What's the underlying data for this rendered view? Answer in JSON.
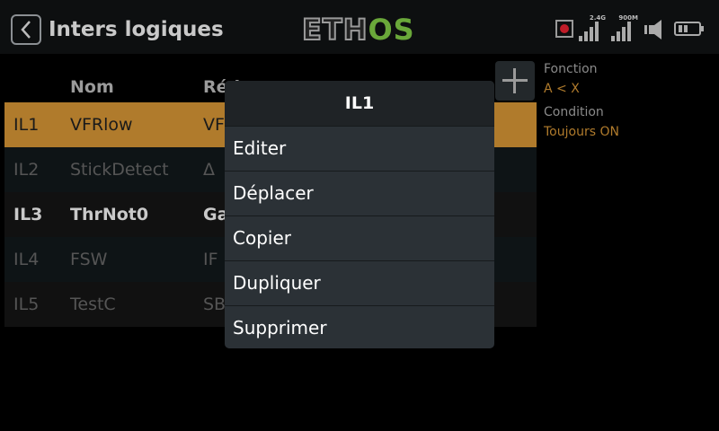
{
  "header": {
    "title": "Inters logiques",
    "logo_left": "ETH",
    "logo_right": "OS",
    "signal1_label": "2.4G",
    "signal2_label": "900M"
  },
  "table": {
    "headers": [
      "Nom",
      "Réd..."
    ],
    "rows": [
      {
        "id": "IL1",
        "name": "VFRlow",
        "value": "VF"
      },
      {
        "id": "IL2",
        "name": "StickDetect",
        "value": "Δ"
      },
      {
        "id": "IL3",
        "name": "ThrNot0",
        "value": "Ga"
      },
      {
        "id": "IL4",
        "name": "FSW",
        "value": "IF"
      },
      {
        "id": "IL5",
        "name": "TestC",
        "value": "SB"
      }
    ]
  },
  "side": {
    "fonction_label": "Fonction",
    "fonction_value": "A < X",
    "condition_label": "Condition",
    "condition_value": "Toujours ON"
  },
  "modal": {
    "title": "IL1",
    "items": [
      "Editer",
      "Déplacer",
      "Copier",
      "Dupliquer",
      "Supprimer"
    ]
  },
  "colors": {
    "accent": "#b07b2c",
    "logo_green": "#6aa83a",
    "rec_red": "#c01c28"
  }
}
